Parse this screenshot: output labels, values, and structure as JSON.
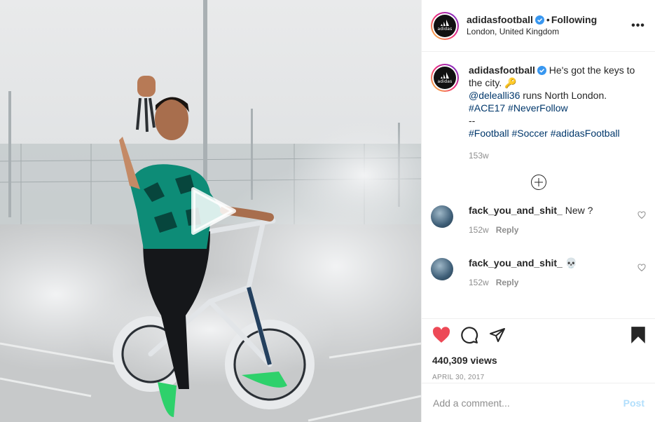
{
  "post": {
    "author": "adidasfootball",
    "follow_state": "Following",
    "location": "London, United Kingdom",
    "avatar_text": "adidas",
    "more_options": "•••"
  },
  "caption": {
    "author": "adidasfootball",
    "line1": "He's got the keys to the city. 🔑",
    "mention": "@delealli36",
    "line2": " runs North London.",
    "tag1": "#ACE17",
    "tag2": "#NeverFollow",
    "separator": "--",
    "tag3": "#Football",
    "tag4": "#Soccer",
    "tag5": "#adidasFootball",
    "time": "153w"
  },
  "comments": [
    {
      "user": "fack_you_and_shit_",
      "text": "New ?",
      "time": "152w",
      "reply": "Reply"
    },
    {
      "user": "fack_you_and_shit_",
      "text": "💀",
      "time": "152w",
      "reply": "Reply"
    }
  ],
  "stats": {
    "views": "440,309 views",
    "date": "APRIL 30, 2017"
  },
  "composer": {
    "placeholder": "Add a comment...",
    "post_label": "Post"
  },
  "colors": {
    "liked": "#ed4956",
    "link": "#00376b",
    "verified": "#3897f0",
    "post_disabled": "#b2dffc"
  }
}
